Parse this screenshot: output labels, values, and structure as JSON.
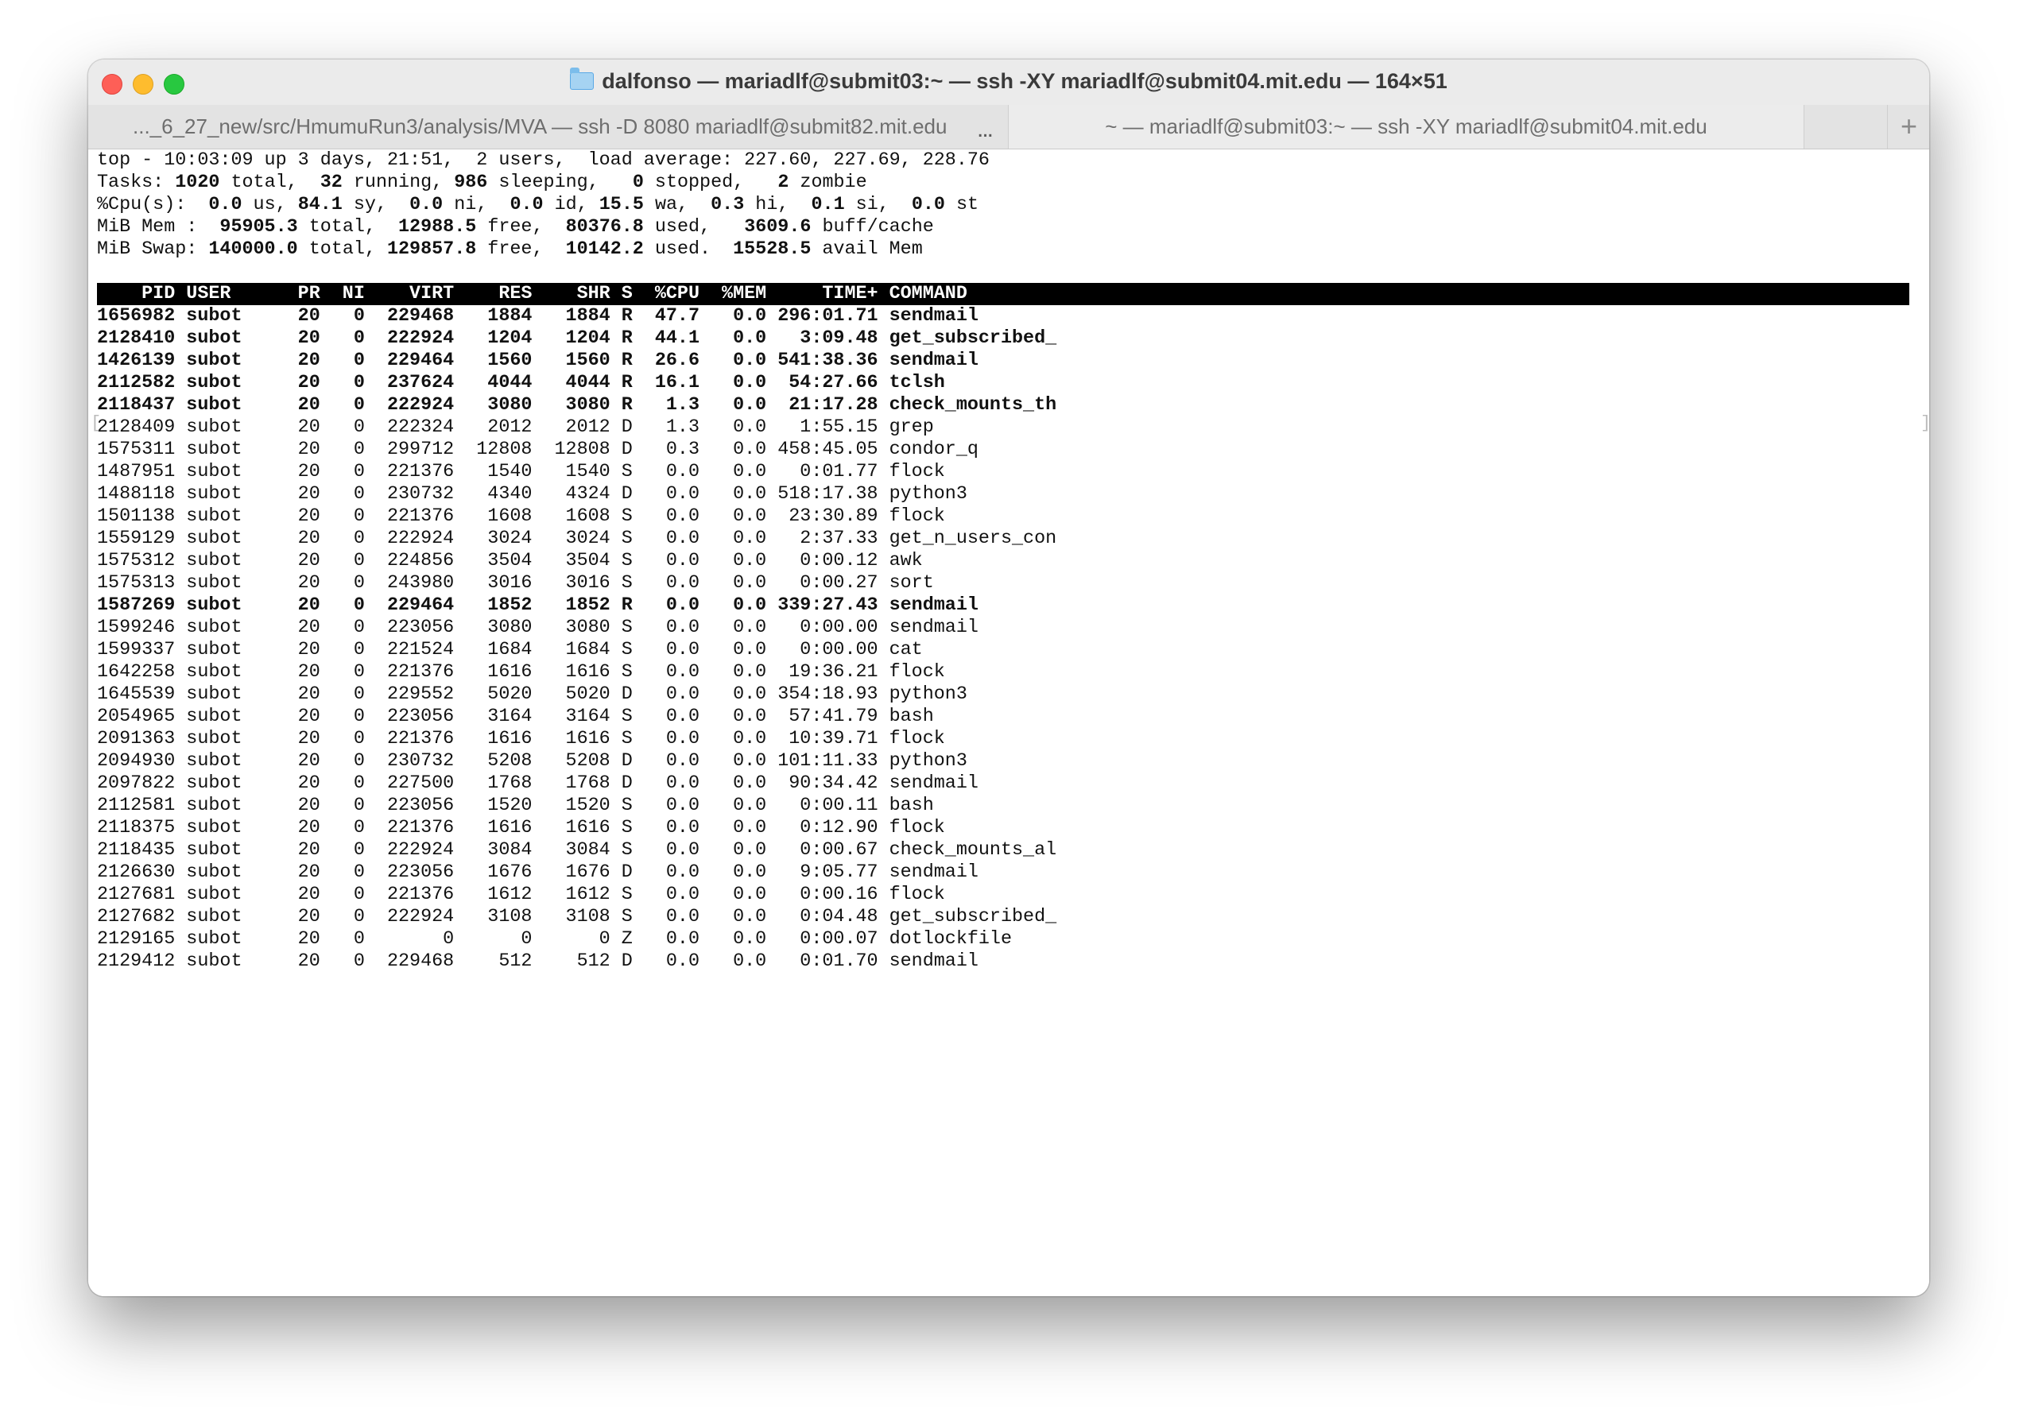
{
  "window": {
    "title": "dalfonso — mariadlf@submit03:~ — ssh -XY mariadlf@submit04.mit.edu — 164×51",
    "title_icon": "folder-icon"
  },
  "tabs": [
    {
      "label": "..._6_27_new/src/HmumuRun3/analysis/MVA — ssh -D 8080 mariadlf@submit82.mit.edu",
      "active": false
    },
    {
      "label": "~ — mariadlf@submit03:~ — ssh -XY mariadlf@submit04.mit.edu",
      "active": true
    }
  ],
  "tab_overflow": "...",
  "new_tab_label": "+",
  "summary": {
    "top": {
      "prefix": "top - 10:03:09 up 3 days, 21:51,  2 users,  load average: 227.60, 227.69, 228.76"
    },
    "tasks": {
      "label": "Tasks:",
      "total": "1020",
      "running": "32",
      "sleeping": "986",
      "stopped": "0",
      "zombie": "2"
    },
    "cpu": {
      "label": "%Cpu(s):",
      "us": "0.0",
      "sy": "84.1",
      "ni": "0.0",
      "id": "0.0",
      "wa": "15.5",
      "hi": "0.3",
      "si": "0.1",
      "st": "0.0"
    },
    "mem": {
      "label": "MiB Mem :",
      "total": "95905.3",
      "free": "12988.5",
      "used": "80376.8",
      "buff_cache": "3609.6"
    },
    "swap": {
      "label": "MiB Swap:",
      "total": "140000.0",
      "free": "129857.8",
      "used": "10142.2",
      "avail": "15528.5"
    }
  },
  "columns": [
    "PID",
    "USER",
    "PR",
    "NI",
    "VIRT",
    "RES",
    "SHR",
    "S",
    "%CPU",
    "%MEM",
    "TIME+",
    "COMMAND"
  ],
  "processes": [
    {
      "pid": "1656982",
      "user": "subot",
      "pr": "20",
      "ni": "0",
      "virt": "229468",
      "res": "1884",
      "shr": "1884",
      "s": "R",
      "cpu": "47.7",
      "mem": "0.0",
      "time": "296:01.71",
      "command": "sendmail",
      "bold": true
    },
    {
      "pid": "2128410",
      "user": "subot",
      "pr": "20",
      "ni": "0",
      "virt": "222924",
      "res": "1204",
      "shr": "1204",
      "s": "R",
      "cpu": "44.1",
      "mem": "0.0",
      "time": "3:09.48",
      "command": "get_subscribed_",
      "bold": true
    },
    {
      "pid": "1426139",
      "user": "subot",
      "pr": "20",
      "ni": "0",
      "virt": "229464",
      "res": "1560",
      "shr": "1560",
      "s": "R",
      "cpu": "26.6",
      "mem": "0.0",
      "time": "541:38.36",
      "command": "sendmail",
      "bold": true
    },
    {
      "pid": "2112582",
      "user": "subot",
      "pr": "20",
      "ni": "0",
      "virt": "237624",
      "res": "4044",
      "shr": "4044",
      "s": "R",
      "cpu": "16.1",
      "mem": "0.0",
      "time": "54:27.66",
      "command": "tclsh",
      "bold": true
    },
    {
      "pid": "2118437",
      "user": "subot",
      "pr": "20",
      "ni": "0",
      "virt": "222924",
      "res": "3080",
      "shr": "3080",
      "s": "R",
      "cpu": "1.3",
      "mem": "0.0",
      "time": "21:17.28",
      "command": "check_mounts_th",
      "bold": true
    },
    {
      "pid": "2128409",
      "user": "subot",
      "pr": "20",
      "ni": "0",
      "virt": "222324",
      "res": "2012",
      "shr": "2012",
      "s": "D",
      "cpu": "1.3",
      "mem": "0.0",
      "time": "1:55.15",
      "command": "grep",
      "bold": false
    },
    {
      "pid": "1575311",
      "user": "subot",
      "pr": "20",
      "ni": "0",
      "virt": "299712",
      "res": "12808",
      "shr": "12808",
      "s": "D",
      "cpu": "0.3",
      "mem": "0.0",
      "time": "458:45.05",
      "command": "condor_q",
      "bold": false
    },
    {
      "pid": "1487951",
      "user": "subot",
      "pr": "20",
      "ni": "0",
      "virt": "221376",
      "res": "1540",
      "shr": "1540",
      "s": "S",
      "cpu": "0.0",
      "mem": "0.0",
      "time": "0:01.77",
      "command": "flock",
      "bold": false
    },
    {
      "pid": "1488118",
      "user": "subot",
      "pr": "20",
      "ni": "0",
      "virt": "230732",
      "res": "4340",
      "shr": "4324",
      "s": "D",
      "cpu": "0.0",
      "mem": "0.0",
      "time": "518:17.38",
      "command": "python3",
      "bold": false
    },
    {
      "pid": "1501138",
      "user": "subot",
      "pr": "20",
      "ni": "0",
      "virt": "221376",
      "res": "1608",
      "shr": "1608",
      "s": "S",
      "cpu": "0.0",
      "mem": "0.0",
      "time": "23:30.89",
      "command": "flock",
      "bold": false
    },
    {
      "pid": "1559129",
      "user": "subot",
      "pr": "20",
      "ni": "0",
      "virt": "222924",
      "res": "3024",
      "shr": "3024",
      "s": "S",
      "cpu": "0.0",
      "mem": "0.0",
      "time": "2:37.33",
      "command": "get_n_users_con",
      "bold": false
    },
    {
      "pid": "1575312",
      "user": "subot",
      "pr": "20",
      "ni": "0",
      "virt": "224856",
      "res": "3504",
      "shr": "3504",
      "s": "S",
      "cpu": "0.0",
      "mem": "0.0",
      "time": "0:00.12",
      "command": "awk",
      "bold": false
    },
    {
      "pid": "1575313",
      "user": "subot",
      "pr": "20",
      "ni": "0",
      "virt": "243980",
      "res": "3016",
      "shr": "3016",
      "s": "S",
      "cpu": "0.0",
      "mem": "0.0",
      "time": "0:00.27",
      "command": "sort",
      "bold": false
    },
    {
      "pid": "1587269",
      "user": "subot",
      "pr": "20",
      "ni": "0",
      "virt": "229464",
      "res": "1852",
      "shr": "1852",
      "s": "R",
      "cpu": "0.0",
      "mem": "0.0",
      "time": "339:27.43",
      "command": "sendmail",
      "bold": true
    },
    {
      "pid": "1599246",
      "user": "subot",
      "pr": "20",
      "ni": "0",
      "virt": "223056",
      "res": "3080",
      "shr": "3080",
      "s": "S",
      "cpu": "0.0",
      "mem": "0.0",
      "time": "0:00.00",
      "command": "sendmail",
      "bold": false
    },
    {
      "pid": "1599337",
      "user": "subot",
      "pr": "20",
      "ni": "0",
      "virt": "221524",
      "res": "1684",
      "shr": "1684",
      "s": "S",
      "cpu": "0.0",
      "mem": "0.0",
      "time": "0:00.00",
      "command": "cat",
      "bold": false
    },
    {
      "pid": "1642258",
      "user": "subot",
      "pr": "20",
      "ni": "0",
      "virt": "221376",
      "res": "1616",
      "shr": "1616",
      "s": "S",
      "cpu": "0.0",
      "mem": "0.0",
      "time": "19:36.21",
      "command": "flock",
      "bold": false
    },
    {
      "pid": "1645539",
      "user": "subot",
      "pr": "20",
      "ni": "0",
      "virt": "229552",
      "res": "5020",
      "shr": "5020",
      "s": "D",
      "cpu": "0.0",
      "mem": "0.0",
      "time": "354:18.93",
      "command": "python3",
      "bold": false
    },
    {
      "pid": "2054965",
      "user": "subot",
      "pr": "20",
      "ni": "0",
      "virt": "223056",
      "res": "3164",
      "shr": "3164",
      "s": "S",
      "cpu": "0.0",
      "mem": "0.0",
      "time": "57:41.79",
      "command": "bash",
      "bold": false
    },
    {
      "pid": "2091363",
      "user": "subot",
      "pr": "20",
      "ni": "0",
      "virt": "221376",
      "res": "1616",
      "shr": "1616",
      "s": "S",
      "cpu": "0.0",
      "mem": "0.0",
      "time": "10:39.71",
      "command": "flock",
      "bold": false
    },
    {
      "pid": "2094930",
      "user": "subot",
      "pr": "20",
      "ni": "0",
      "virt": "230732",
      "res": "5208",
      "shr": "5208",
      "s": "D",
      "cpu": "0.0",
      "mem": "0.0",
      "time": "101:11.33",
      "command": "python3",
      "bold": false
    },
    {
      "pid": "2097822",
      "user": "subot",
      "pr": "20",
      "ni": "0",
      "virt": "227500",
      "res": "1768",
      "shr": "1768",
      "s": "D",
      "cpu": "0.0",
      "mem": "0.0",
      "time": "90:34.42",
      "command": "sendmail",
      "bold": false
    },
    {
      "pid": "2112581",
      "user": "subot",
      "pr": "20",
      "ni": "0",
      "virt": "223056",
      "res": "1520",
      "shr": "1520",
      "s": "S",
      "cpu": "0.0",
      "mem": "0.0",
      "time": "0:00.11",
      "command": "bash",
      "bold": false
    },
    {
      "pid": "2118375",
      "user": "subot",
      "pr": "20",
      "ni": "0",
      "virt": "221376",
      "res": "1616",
      "shr": "1616",
      "s": "S",
      "cpu": "0.0",
      "mem": "0.0",
      "time": "0:12.90",
      "command": "flock",
      "bold": false
    },
    {
      "pid": "2118435",
      "user": "subot",
      "pr": "20",
      "ni": "0",
      "virt": "222924",
      "res": "3084",
      "shr": "3084",
      "s": "S",
      "cpu": "0.0",
      "mem": "0.0",
      "time": "0:00.67",
      "command": "check_mounts_al",
      "bold": false
    },
    {
      "pid": "2126630",
      "user": "subot",
      "pr": "20",
      "ni": "0",
      "virt": "223056",
      "res": "1676",
      "shr": "1676",
      "s": "D",
      "cpu": "0.0",
      "mem": "0.0",
      "time": "9:05.77",
      "command": "sendmail",
      "bold": false
    },
    {
      "pid": "2127681",
      "user": "subot",
      "pr": "20",
      "ni": "0",
      "virt": "221376",
      "res": "1612",
      "shr": "1612",
      "s": "S",
      "cpu": "0.0",
      "mem": "0.0",
      "time": "0:00.16",
      "command": "flock",
      "bold": false
    },
    {
      "pid": "2127682",
      "user": "subot",
      "pr": "20",
      "ni": "0",
      "virt": "222924",
      "res": "3108",
      "shr": "3108",
      "s": "S",
      "cpu": "0.0",
      "mem": "0.0",
      "time": "0:04.48",
      "command": "get_subscribed_",
      "bold": false
    },
    {
      "pid": "2129165",
      "user": "subot",
      "pr": "20",
      "ni": "0",
      "virt": "0",
      "res": "0",
      "shr": "0",
      "s": "Z",
      "cpu": "0.0",
      "mem": "0.0",
      "time": "0:00.07",
      "command": "dotlockfile",
      "bold": false
    },
    {
      "pid": "2129412",
      "user": "subot",
      "pr": "20",
      "ni": "0",
      "virt": "229468",
      "res": "512",
      "shr": "512",
      "s": "D",
      "cpu": "0.0",
      "mem": "0.0",
      "time": "0:01.70",
      "command": "sendmail",
      "bold": false
    }
  ]
}
